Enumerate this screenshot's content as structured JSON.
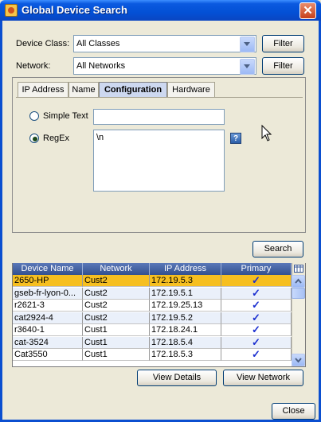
{
  "window": {
    "title": "Global Device Search",
    "close_glyph": "✕",
    "close": "Close"
  },
  "filters": {
    "device_class_label": "Device Class:",
    "device_class_value": "All Classes",
    "network_label": "Network:",
    "network_value": "All Networks",
    "filter_label": "Filter"
  },
  "tabs": [
    "IP Address",
    "Name",
    "Configuration",
    "Hardware"
  ],
  "active_tab": "Configuration",
  "config": {
    "simple_text_label": "Simple Text",
    "regex_label": "RegEx",
    "regex_value": "\\n",
    "help": "?"
  },
  "search_label": "Search",
  "table": {
    "columns": [
      "Device Name",
      "Network",
      "IP Address",
      "Primary"
    ],
    "rows": [
      [
        "2650-HP",
        "Cust2",
        "172.19.5.3",
        "✓"
      ],
      [
        "gseb-fr-lyon-0...",
        "Cust2",
        "172.19.5.1",
        "✓"
      ],
      [
        "r2621-3",
        "Cust2",
        "172.19.25.13",
        "✓"
      ],
      [
        "cat2924-4",
        "Cust2",
        "172.19.5.2",
        "✓"
      ],
      [
        "r3640-1",
        "Cust1",
        "172.18.24.1",
        "✓"
      ],
      [
        "cat-3524",
        "Cust1",
        "172.18.5.4",
        "✓"
      ],
      [
        "Cat3550",
        "Cust1",
        "172.18.5.3",
        "✓"
      ]
    ]
  },
  "view_details": "View Details",
  "view_network": "View Network",
  "colors": {
    "selected_row": "#f6bf20",
    "title_bar": "#0350d5",
    "header": "#3a5896"
  }
}
